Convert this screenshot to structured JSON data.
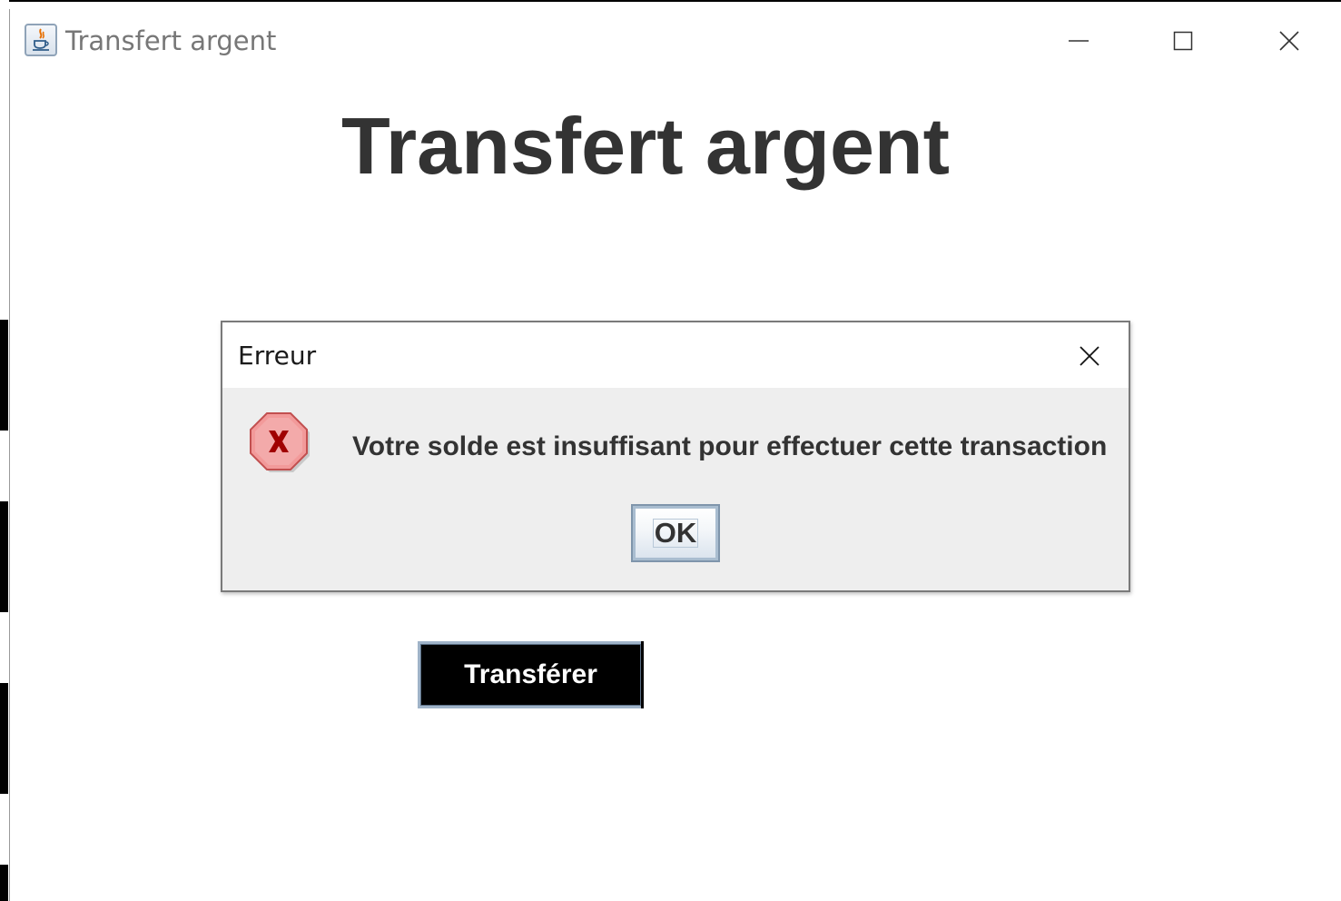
{
  "window": {
    "title": "Transfert argent",
    "icon": "java-icon",
    "controls": [
      "minimize-icon",
      "maximize-icon",
      "close-icon"
    ]
  },
  "main": {
    "heading": "Transfert argent",
    "transfer_button_label": "Transférer"
  },
  "dialog": {
    "title": "Erreur",
    "icon": "error-icon",
    "message": "Votre solde est insuffisant pour effectuer cette transaction",
    "ok_label": "OK"
  },
  "colors": {
    "heading_text": "#333333",
    "transfer_button_bg": "#000000",
    "dialog_bg": "#eeeeee",
    "error_icon_fill": "#f08a8a",
    "error_icon_mark": "#a00000"
  }
}
